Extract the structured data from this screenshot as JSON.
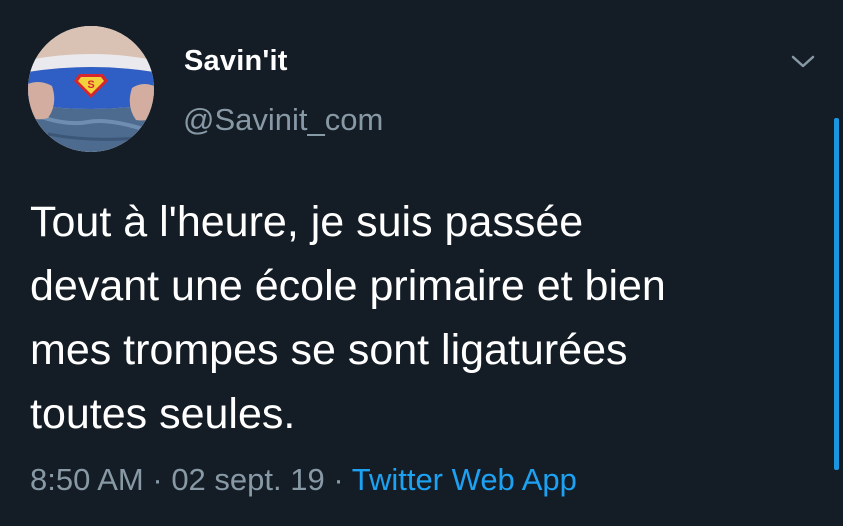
{
  "tweet": {
    "display_name": "Savin'it",
    "handle": "@Savinit_com",
    "text": "Tout à l'heure, je suis passée\ndevant une école primaire et bien\nmes trompes se sont ligaturées\ntoutes seules.",
    "time": "8:50 AM",
    "separator_1": " · ",
    "date": "02 sept. 19",
    "separator_2": " · ",
    "source": "Twitter Web App",
    "avatar_icon": "profile-photo-superman-underwear",
    "menu_icon": "chevron-down-icon"
  },
  "colors": {
    "background": "#141d26",
    "text": "#ffffff",
    "muted": "#8899a6",
    "accent": "#1da1f2"
  }
}
